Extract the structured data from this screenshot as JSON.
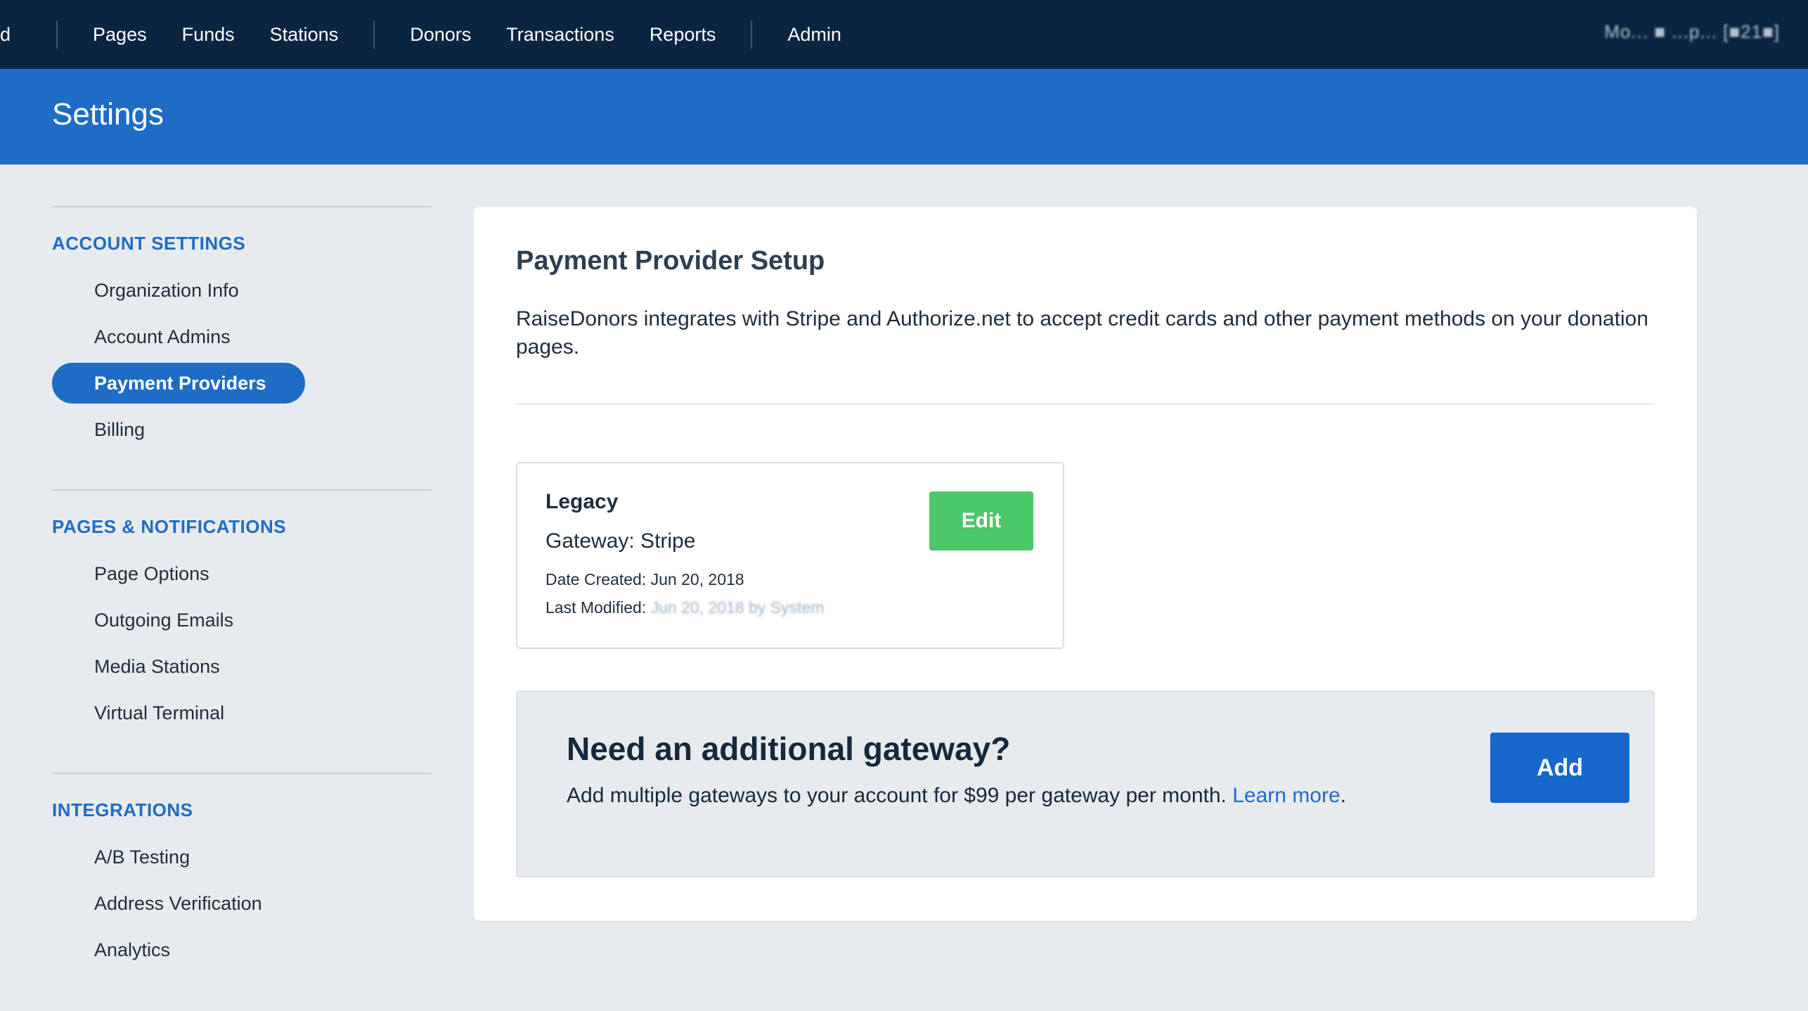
{
  "topnav": {
    "cut_item": "d",
    "groups": [
      [
        "Pages",
        "Funds",
        "Stations"
      ],
      [
        "Donors",
        "Transactions",
        "Reports"
      ],
      [
        "Admin"
      ]
    ],
    "user_label": "Mo... ■ ...p... [■21■]"
  },
  "header": {
    "title": "Settings"
  },
  "sidebar": {
    "sections": [
      {
        "title": "ACCOUNT SETTINGS",
        "items": [
          "Organization Info",
          "Account Admins",
          "Payment Providers",
          "Billing"
        ]
      },
      {
        "title": "PAGES & NOTIFICATIONS",
        "items": [
          "Page Options",
          "Outgoing Emails",
          "Media Stations",
          "Virtual Terminal"
        ]
      },
      {
        "title": "INTEGRATIONS",
        "items": [
          "A/B Testing",
          "Address Verification",
          "Analytics"
        ]
      }
    ],
    "active_item": "Payment Providers"
  },
  "main": {
    "title": "Payment Provider Setup",
    "intro": "RaiseDonors integrates with Stripe and Authorize.net to accept credit cards and other payment methods on your donation pages.",
    "provider": {
      "name": "Legacy",
      "gateway": "Gateway: Stripe",
      "created": "Date Created: Jun 20, 2018",
      "modified_label": "Last Modified:",
      "modified_value": "Jun 20, 2018 by System",
      "edit_label": "Edit"
    },
    "upsell": {
      "title": "Need an additional gateway?",
      "desc": "Add multiple gateways to your account for $99 per gateway per month.",
      "link": "Learn more",
      "link_suffix": ".",
      "add_label": "Add"
    }
  },
  "colors": {
    "nav_bg": "#0b2540",
    "header_bg": "#1f6cc6",
    "accent": "#1f6cc6",
    "edit_green": "#4cc76a",
    "add_blue": "#1767cc"
  }
}
